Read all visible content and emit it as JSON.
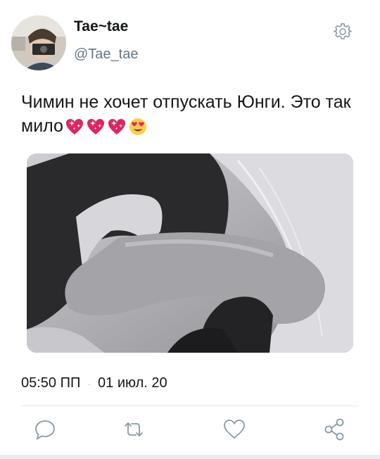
{
  "user": {
    "display_name": "Tae~tae",
    "handle": "@Tae_tae",
    "avatar_icon": "profile-photo"
  },
  "header": {
    "settings_icon": "gear-icon"
  },
  "tweet": {
    "text": "Чимин не хочет отпускать Юнги. Это так мило",
    "emojis": [
      "sparkling-heart",
      "sparkling-heart",
      "sparkling-heart",
      "heart-eyes-face"
    ],
    "media_description_icon": "photo"
  },
  "meta": {
    "time": "05:50 ПП",
    "separator": "·",
    "date": "01 июл. 20"
  },
  "actions": {
    "reply_icon": "reply-icon",
    "retweet_icon": "retweet-icon",
    "like_icon": "heart-icon",
    "share_icon": "share-icon"
  },
  "colors": {
    "text": "#14171a",
    "secondary": "#657786",
    "accent": "#1da1f2",
    "icon": "#657786"
  }
}
